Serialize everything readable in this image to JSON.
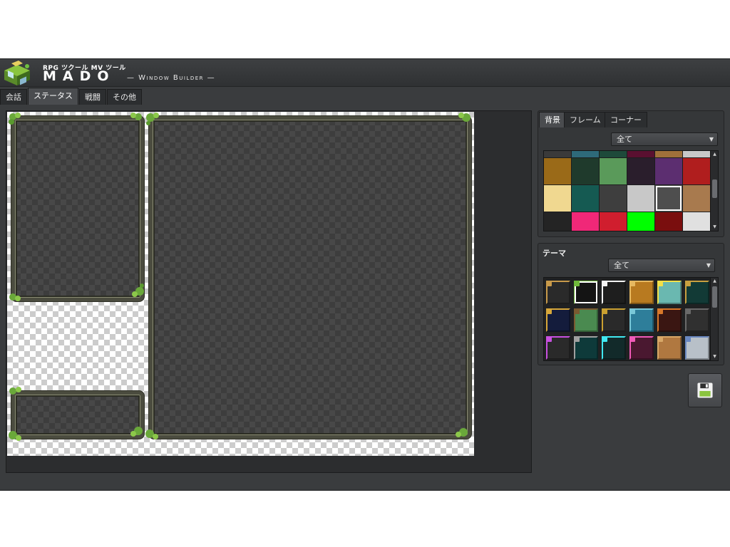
{
  "header": {
    "subtitle": "RPG ツクール MV ツール",
    "brand": "MADO",
    "brand_sub": "— Window Builder —",
    "logo_icon": "window-cube-logo"
  },
  "tabs": [
    {
      "label": "会話",
      "active": false
    },
    {
      "label": "ステータス",
      "active": true
    },
    {
      "label": "戦闘",
      "active": false
    },
    {
      "label": "その他",
      "active": false
    }
  ],
  "background_panel": {
    "tabs": [
      {
        "label": "背景",
        "active": true
      },
      {
        "label": "フレーム",
        "active": false
      },
      {
        "label": "コーナー",
        "active": false
      }
    ],
    "filter_value": "全て",
    "selected_index": 10,
    "swatches": [
      "#9a6a18",
      "#1f3a2c",
      "#5a9a5a",
      "#2a1e2c",
      "#5c2e70",
      "#b01e1e",
      "#f0d890",
      "#155a52",
      "#3e3e3e",
      "#c8c8c8",
      "#4e4e4e",
      "#a87a4e",
      "#242424",
      "#f02878",
      "#d01e2e",
      "#00ff00",
      "#7a0e0e",
      "#e0e0e0"
    ]
  },
  "theme_panel": {
    "title": "テーマ",
    "filter_value": "全て",
    "selected_index": 1,
    "themes": [
      {
        "fill": "#2a2a2a",
        "corner": "#c89a4a"
      },
      {
        "fill": "#141414",
        "corner": "#6fb83a"
      },
      {
        "fill": "#1e1e1e",
        "corner": "#f4f4f4"
      },
      {
        "fill": "#b87a20",
        "corner": "#e6b860"
      },
      {
        "fill": "#6ab8b0",
        "corner": "#f2e04a"
      },
      {
        "fill": "#123a36",
        "corner": "#c8a040"
      },
      {
        "fill": "#141c3c",
        "corner": "#d8a83a"
      },
      {
        "fill": "#4a8a50",
        "corner": "#7a5a30"
      },
      {
        "fill": "#2a2a2a",
        "corner": "#caa030"
      },
      {
        "fill": "#2e7e9a",
        "corner": "#7ac8d8"
      },
      {
        "fill": "#3a1612",
        "corner": "#d8782a"
      },
      {
        "fill": "#303030",
        "corner": "#6a6a6a"
      },
      {
        "fill": "#2a2a2a",
        "corner": "#c850e0"
      },
      {
        "fill": "#0e3a3a",
        "corner": "#a0a0a0"
      },
      {
        "fill": "#122a2a",
        "corner": "#40e8f0"
      },
      {
        "fill": "#4a1830",
        "corner": "#f05ab8"
      },
      {
        "fill": "#b07840",
        "corner": "#d8a868"
      },
      {
        "fill": "#b8c0c8",
        "corner": "#6a88c0"
      }
    ]
  },
  "save_icon": "floppy-disk-icon"
}
